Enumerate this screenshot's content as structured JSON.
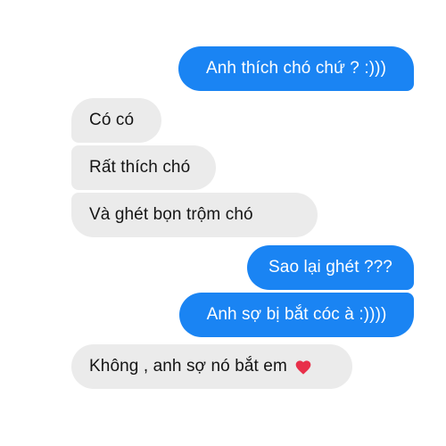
{
  "messages": [
    {
      "sender": "me",
      "text": "Anh thích chó chứ ? :)))"
    },
    {
      "sender": "them",
      "text": "Có có"
    },
    {
      "sender": "them",
      "text": "Rất thích chó"
    },
    {
      "sender": "them",
      "text": "Và ghét bọn trộm chó"
    },
    {
      "sender": "me",
      "text": "Sao lại ghét ???"
    },
    {
      "sender": "me",
      "text": "Anh sợ bị bắt cóc à :))))"
    },
    {
      "sender": "them",
      "text": "Không , anh sợ nó bắt em",
      "emoji": "red-heart-icon"
    }
  ],
  "colors": {
    "sent_bubble": "#1a84f3",
    "received_bubble": "#ebebeb",
    "sent_text": "#ffffff",
    "received_text": "#151515",
    "heart": "#e8304a"
  }
}
